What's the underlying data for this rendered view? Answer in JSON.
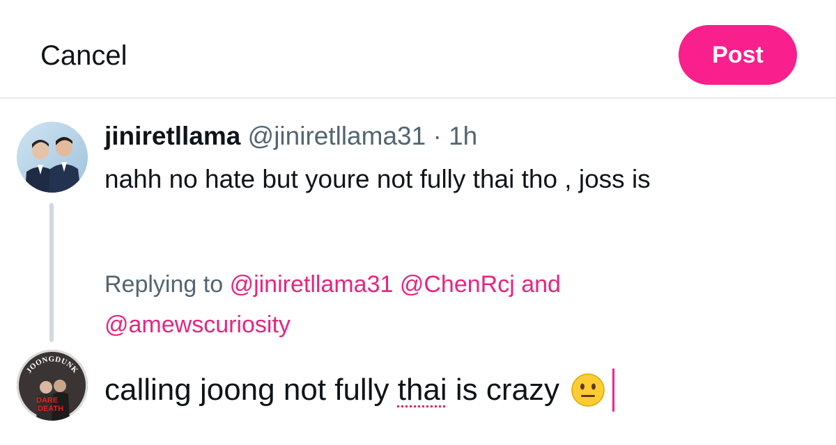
{
  "header": {
    "cancel_label": "Cancel",
    "post_label": "Post",
    "accent_color": "#f91f8c"
  },
  "original_tweet": {
    "display_name": "jiniretllama",
    "handle": "@jiniretllama31",
    "separator": "·",
    "time": "1h",
    "text": "nahh no hate but youre not fully thai tho , joss is",
    "avatar_icon": "user-avatar-photo"
  },
  "replying": {
    "prefix": "Replying to",
    "mention_1": "@jiniretllama31",
    "mention_2": "@ChenRcj",
    "connector": "and",
    "mention_3": "@amewscuriosity",
    "mention_color": "#e8247f"
  },
  "compose": {
    "text_before": "calling joong not fully ",
    "misspelled_word": "thai",
    "text_after": " is crazy",
    "emoji": "neutral-face-emoji",
    "avatar_icon": "user-avatar-poster",
    "avatar_lettering": [
      "JOONGDUNK",
      "DARE",
      "DEATH"
    ]
  }
}
